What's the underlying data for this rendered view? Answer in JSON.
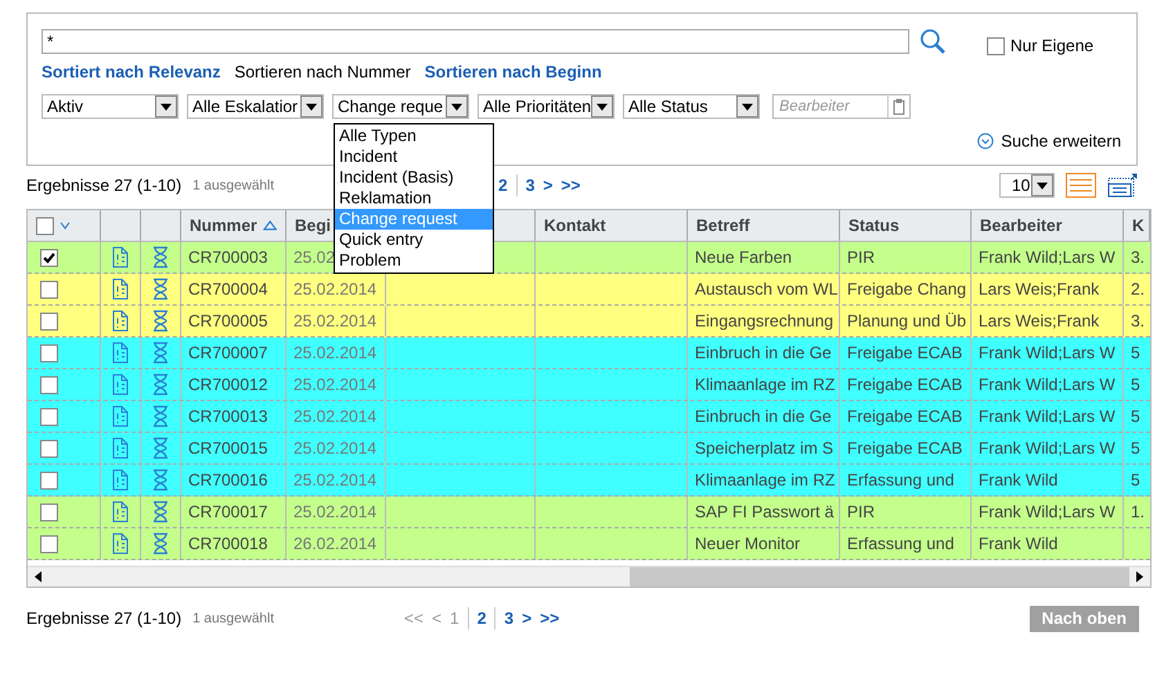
{
  "search": {
    "value": "*"
  },
  "only_own": {
    "label": "Nur Eigene",
    "checked": false
  },
  "sort_options": [
    {
      "label": "Sortiert nach Relevanz",
      "selected": false
    },
    {
      "label": "Sortieren nach Nummer",
      "selected": true
    },
    {
      "label": "Sortieren nach Beginn",
      "selected": false
    }
  ],
  "filters": [
    {
      "kind": "select",
      "value": "Aktiv"
    },
    {
      "kind": "select",
      "value": "Alle Eskalatior"
    },
    {
      "kind": "select",
      "value": "Change reque"
    },
    {
      "kind": "select",
      "value": "Alle Prioritäten"
    },
    {
      "kind": "select",
      "value": "Alle Status"
    },
    {
      "kind": "text",
      "placeholder": "Bearbeiter"
    }
  ],
  "type_dropdown": [
    {
      "label": "Alle Typen",
      "selected": false
    },
    {
      "label": "Incident",
      "selected": false
    },
    {
      "label": "Incident (Basis)",
      "selected": false
    },
    {
      "label": "Reklamation",
      "selected": false
    },
    {
      "label": "Change request",
      "selected": true
    },
    {
      "label": "Quick entry",
      "selected": false
    },
    {
      "label": "Problem",
      "selected": false
    }
  ],
  "expand_search": "Suche erweitern",
  "results_top": {
    "summary": "Ergebnisse 27 (1-10)",
    "selection": "1 ausgewählt",
    "pages": [
      {
        "label": "2",
        "kind": "page",
        "disabled": false
      },
      {
        "label": "3",
        "kind": "page",
        "disabled": false
      },
      {
        "label": ">",
        "kind": "nav",
        "disabled": false
      },
      {
        "label": ">>",
        "kind": "nav",
        "disabled": false
      }
    ]
  },
  "page_size": "10",
  "table": {
    "columns": {
      "number": "Nummer",
      "begin": "Begi",
      "contact": "Kontakt",
      "subject": "Betreff",
      "status": "Status",
      "assignee": "Bearbeiter",
      "column_11": "K"
    },
    "all_checked": false,
    "rows": [
      {
        "checked": true,
        "color": "#c4ff8c",
        "number": "CR700003",
        "begin": "25.02",
        "subject": "Neue Farben",
        "status": "PIR",
        "assignee": "Frank Wild;Lars W",
        "column_11": "3."
      },
      {
        "checked": false,
        "color": "#ffff80",
        "number": "CR700004",
        "begin": "25.02.2014",
        "subject": "Austausch vom WL",
        "status": "Freigabe Chang",
        "assignee": "Lars Weis;Frank",
        "column_11": "2."
      },
      {
        "checked": false,
        "color": "#ffff80",
        "number": "CR700005",
        "begin": "25.02.2014",
        "subject": "Eingangsrechnung",
        "status": "Planung und Üb",
        "assignee": "Lars Weis;Frank",
        "column_11": "3."
      },
      {
        "checked": false,
        "color": "#40ffff",
        "number": "CR700007",
        "begin": "25.02.2014",
        "subject": "Einbruch in die Ge",
        "status": "Freigabe ECAB",
        "assignee": "Frank Wild;Lars W",
        "column_11": "5"
      },
      {
        "checked": false,
        "color": "#40ffff",
        "number": "CR700012",
        "begin": "25.02.2014",
        "subject": "Klimaanlage im RZ",
        "status": "Freigabe ECAB",
        "assignee": "Frank Wild;Lars W",
        "column_11": "5"
      },
      {
        "checked": false,
        "color": "#40ffff",
        "number": "CR700013",
        "begin": "25.02.2014",
        "subject": "Einbruch in die Ge",
        "status": "Freigabe ECAB",
        "assignee": "Frank Wild;Lars W",
        "column_11": "5"
      },
      {
        "checked": false,
        "color": "#40ffff",
        "number": "CR700015",
        "begin": "25.02.2014",
        "subject": "Speicherplatz im S",
        "status": "Freigabe ECAB",
        "assignee": "Frank Wild;Lars W",
        "column_11": "5"
      },
      {
        "checked": false,
        "color": "#40ffff",
        "number": "CR700016",
        "begin": "25.02.2014",
        "subject": "Klimaanlage im RZ",
        "status": "Erfassung und",
        "assignee": "Frank Wild",
        "column_11": "5"
      },
      {
        "checked": false,
        "color": "#c4ff8c",
        "number": "CR700017",
        "begin": "25.02.2014",
        "subject": "SAP FI Passwort ä",
        "status": "PIR",
        "assignee": "Frank Wild;Lars W",
        "column_11": "1."
      },
      {
        "checked": false,
        "color": "#c4ff8c",
        "number": "CR700018",
        "begin": "26.02.2014",
        "subject": "Neuer Monitor",
        "status": "Erfassung und",
        "assignee": "Frank Wild"
      }
    ]
  },
  "results_bottom": {
    "summary": "Ergebnisse 27 (1-10)",
    "selection": "1 ausgewählt",
    "pages": [
      {
        "label": "<<",
        "kind": "nav",
        "disabled": true
      },
      {
        "label": "<",
        "kind": "nav",
        "disabled": true
      },
      {
        "label": "1",
        "kind": "page",
        "disabled": true
      },
      {
        "label": "2",
        "kind": "page",
        "disabled": false
      },
      {
        "label": "3",
        "kind": "page",
        "disabled": false
      },
      {
        "label": ">",
        "kind": "nav",
        "disabled": false
      },
      {
        "label": ">>",
        "kind": "nav",
        "disabled": false
      }
    ]
  },
  "back_to_top": "Nach oben"
}
